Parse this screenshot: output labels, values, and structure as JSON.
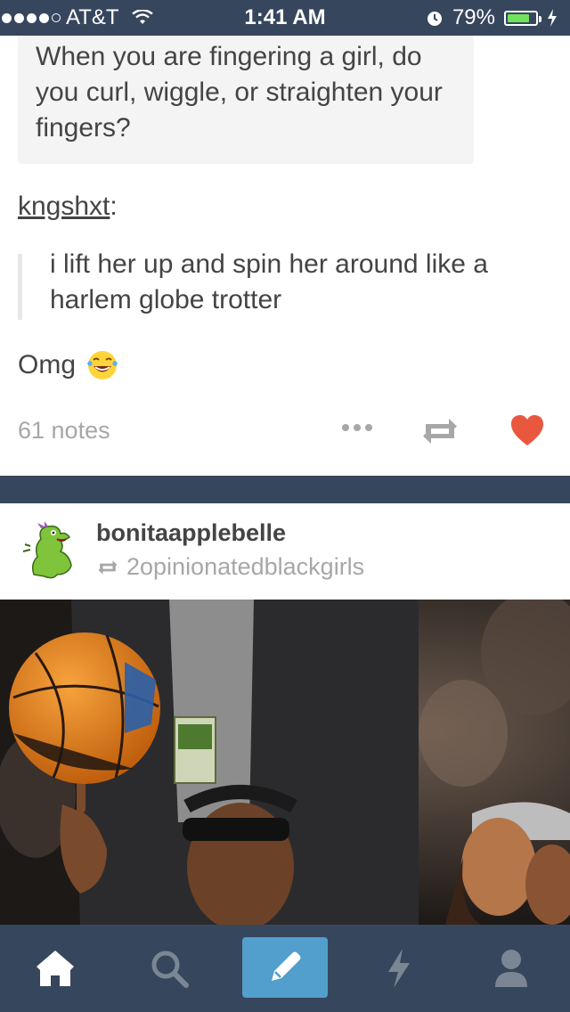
{
  "status_bar": {
    "carrier": "AT&T",
    "time": "1:41 AM",
    "battery_percent": "79%",
    "battery_level": 0.79
  },
  "post1": {
    "question": "When you are fingering a girl, do you curl, wiggle, or straighten your fingers?",
    "reblogger": "kngshxt",
    "reblogger_suffix": ":",
    "quote": "i lift her up and spin her around like a harlem globe trotter",
    "comment": "Omg",
    "comment_emoji": "face-with-tears-of-joy",
    "notes": "61 notes",
    "liked": true,
    "colors": {
      "heart": "#e9573f",
      "muted": "#a7a7a7",
      "text": "#444444"
    }
  },
  "post2": {
    "blog_name": "bonitaapplebelle",
    "reblogged_from": "2opinionatedblackgirls",
    "avatar": "reptar-dinosaur-avatar",
    "photo": "basketball-spin-courtside-photo"
  },
  "tab_bar": {
    "items": [
      {
        "name": "home",
        "icon": "home-icon",
        "active": true
      },
      {
        "name": "search",
        "icon": "search-icon",
        "active": false
      },
      {
        "name": "compose",
        "icon": "pencil-icon",
        "active": false
      },
      {
        "name": "activity",
        "icon": "lightning-icon",
        "active": false
      },
      {
        "name": "account",
        "icon": "person-icon",
        "active": false
      }
    ],
    "colors": {
      "background": "#36465d",
      "compose": "#529ecc",
      "inactive": "#7b8694"
    }
  }
}
